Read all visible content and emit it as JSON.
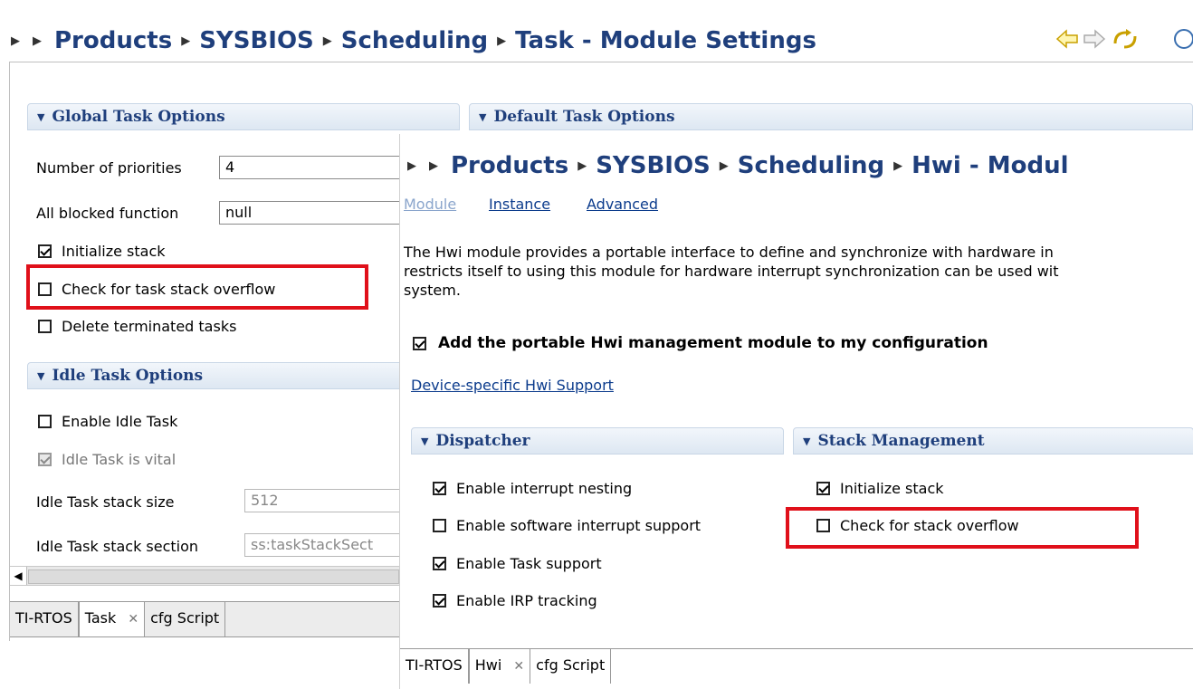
{
  "back_window": {
    "breadcrumb": {
      "items": [
        "Products",
        "SYSBIOS",
        "Scheduling",
        "Task - Module Settings"
      ]
    },
    "nav_icons": [
      "back-arrow-icon",
      "forward-arrow-icon",
      "refresh-icon",
      "help-icon"
    ],
    "global_section": {
      "title": "Global Task Options",
      "num_priorities_label": "Number of priorities",
      "num_priorities_value": "4",
      "all_blocked_label": "All blocked function",
      "all_blocked_value": "null",
      "init_stack_label": "Initialize stack",
      "check_overflow_label": "Check for task stack overflow",
      "delete_terminated_label": "Delete terminated tasks"
    },
    "default_section": {
      "title": "Default Task Options"
    },
    "idle_section": {
      "title": "Idle Task Options",
      "enable_idle_label": "Enable Idle Task",
      "idle_vital_label": "Idle Task is vital",
      "stack_size_label": "Idle Task stack size",
      "stack_size_value": "512",
      "stack_section_label": "Idle Task stack section",
      "stack_section_value": "ss:taskStackSect"
    },
    "tabs": [
      "TI-RTOS",
      "Task",
      "cfg Script"
    ]
  },
  "front_window": {
    "breadcrumb": {
      "items": [
        "Products",
        "SYSBIOS",
        "Scheduling",
        "Hwi - Modul"
      ]
    },
    "subnav": [
      "Module",
      "Instance",
      "Advanced"
    ],
    "description": " The Hwi module provides a portable interface to define and synchronize with hardware in restricts itself to using this module for hardware interrupt synchronization can be used wit system.",
    "desc_line1": " The Hwi module provides a portable interface to define and synchronize with hardware in",
    "desc_line2": "restricts itself to using this module for hardware interrupt synchronization can be used wit",
    "desc_line3": "system.",
    "add_module_label": "Add the portable Hwi management module to my configuration",
    "device_link": "Device-specific Hwi Support",
    "dispatcher": {
      "title": "Dispatcher",
      "items": [
        {
          "label": "Enable interrupt nesting",
          "checked": true
        },
        {
          "label": "Enable software interrupt support",
          "checked": false
        },
        {
          "label": "Enable Task support",
          "checked": true
        },
        {
          "label": "Enable IRP tracking",
          "checked": true
        }
      ]
    },
    "stack_mgmt": {
      "title": "Stack Management",
      "items": [
        {
          "label": "Initialize stack",
          "checked": true
        },
        {
          "label": "Check for stack overflow",
          "checked": false
        }
      ]
    },
    "tabs": [
      "TI-RTOS",
      "Hwi",
      "cfg Script"
    ]
  },
  "colors": {
    "highlight": "#e0101a",
    "breadcrumb": "#1f3f7c",
    "link": "#0b3b8c"
  }
}
